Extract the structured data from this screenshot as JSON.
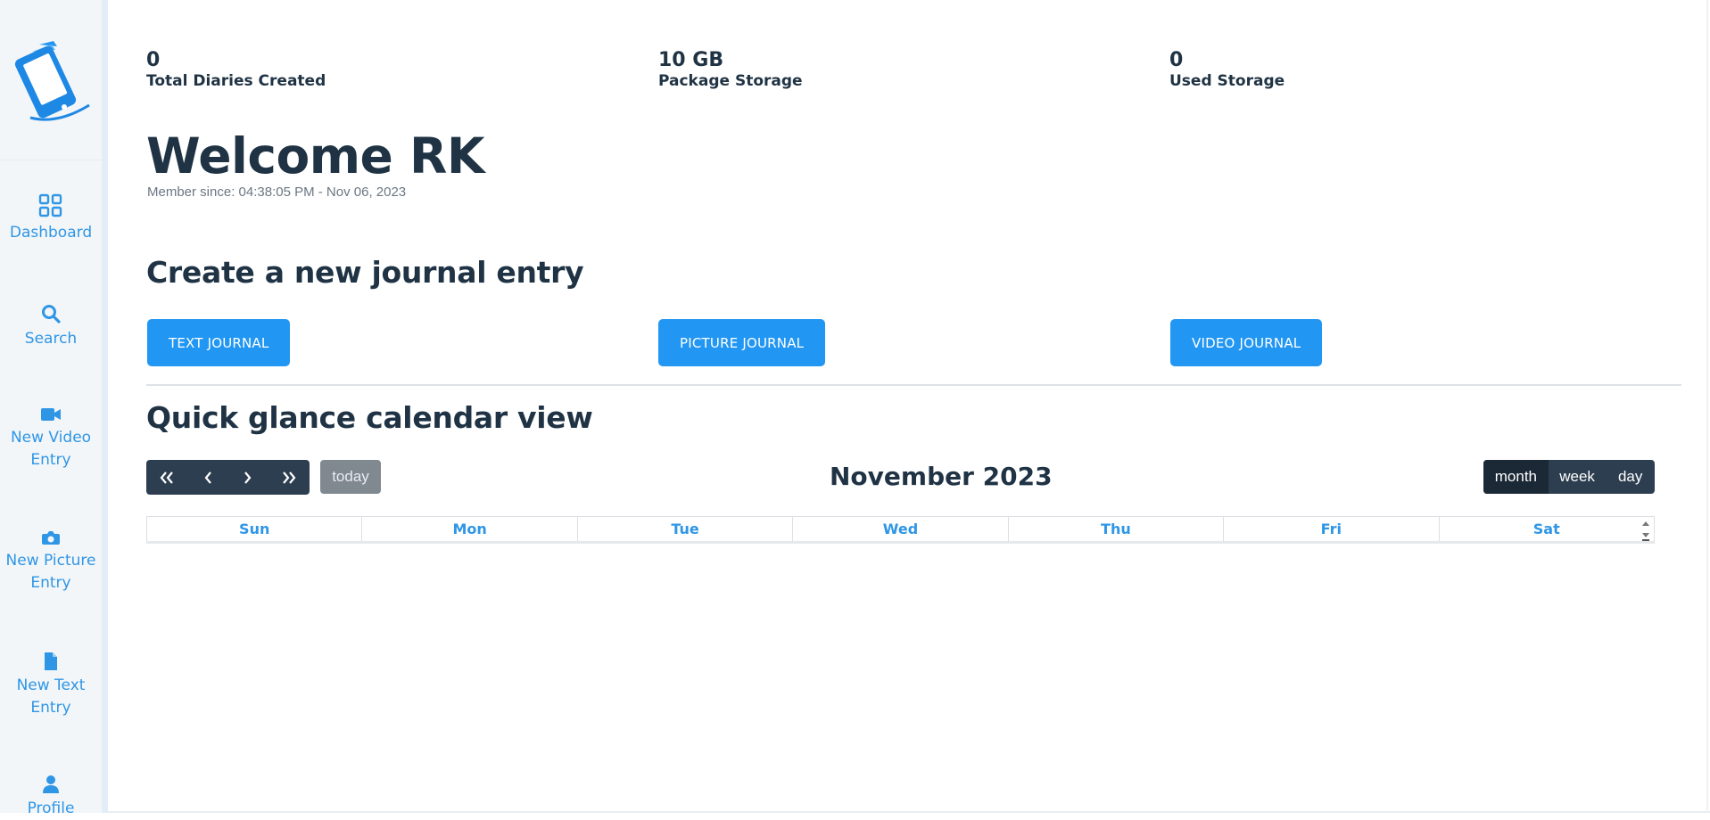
{
  "sidebar": {
    "items": [
      {
        "label_line1": "Dashboard",
        "label_line2": "",
        "icon": "grid-icon"
      },
      {
        "label_line1": "Search",
        "label_line2": "",
        "icon": "search-icon"
      },
      {
        "label_line1": "New Video",
        "label_line2": "Entry",
        "icon": "video-camera-icon"
      },
      {
        "label_line1": "New Picture",
        "label_line2": "Entry",
        "icon": "camera-icon"
      },
      {
        "label_line1": "New Text",
        "label_line2": "Entry",
        "icon": "file-icon"
      },
      {
        "label_line1": "Profile",
        "label_line2": "",
        "icon": "user-icon"
      }
    ],
    "accent": "#2f96e6"
  },
  "stats": [
    {
      "value": "0",
      "label": "Total Diaries Created"
    },
    {
      "value": "10 GB",
      "label": "Package Storage"
    },
    {
      "value": "0",
      "label": "Used Storage"
    }
  ],
  "welcome": {
    "title": "Welcome RK",
    "member_since": "Member since: 04:38:05 PM - Nov 06, 2023"
  },
  "create": {
    "heading": "Create a new journal entry",
    "buttons": [
      "TEXT JOURNAL",
      "PICTURE JOURNAL",
      "VIDEO JOURNAL"
    ],
    "button_color": "#2196f3"
  },
  "calendar": {
    "heading": "Quick glance calendar view",
    "today_label": "today",
    "title": "November 2023",
    "views": [
      "month",
      "week",
      "day"
    ],
    "active_view": "month",
    "days": [
      "Sun",
      "Mon",
      "Tue",
      "Wed",
      "Thu",
      "Fri",
      "Sat"
    ],
    "toolbar_color": "#2c3e50"
  }
}
